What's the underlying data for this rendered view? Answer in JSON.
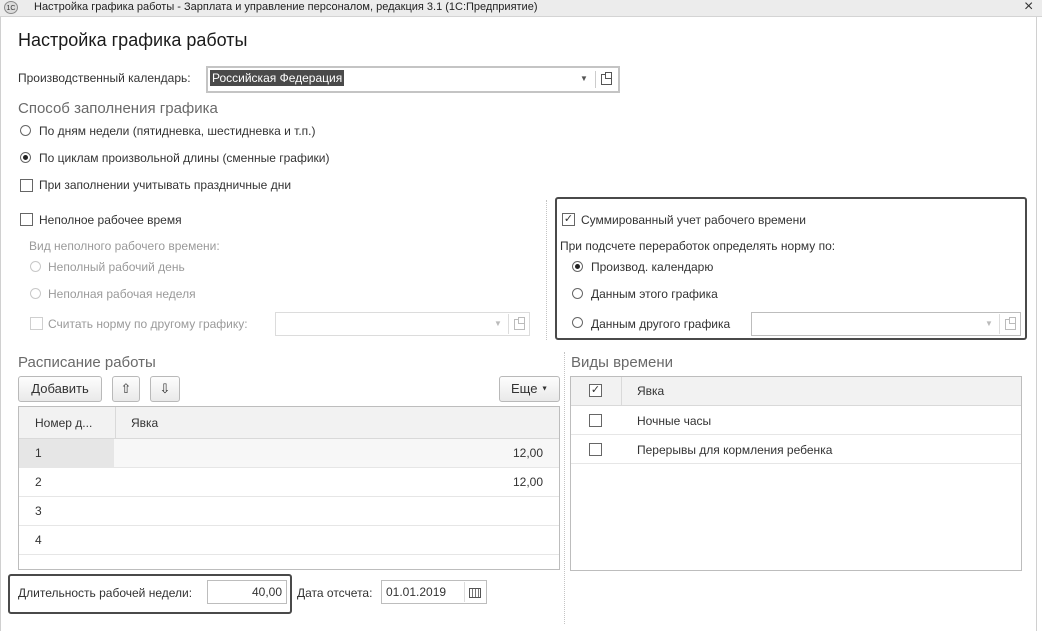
{
  "window": {
    "title": "Настройка графика работы - Зарплата и управление персоналом, редакция 3.1  (1С:Предприятие)",
    "icon_text": "1С",
    "close_glyph": "×"
  },
  "form": {
    "title": "Настройка графика работы"
  },
  "calendar": {
    "label": "Производственный календарь:",
    "value": "Российская Федерация"
  },
  "fill_method": {
    "title": "Способ заполнения графика",
    "option_weekdays": "По дням недели (пятидневка, шестидневка и т.п.)",
    "option_cycles": "По циклам произвольной длины (сменные графики)",
    "selected": "cycles",
    "holidays_label": "При заполнении учитывать праздничные дни",
    "holidays_checked": false
  },
  "part_time": {
    "label": "Неполное рабочее время",
    "checked": false,
    "kind_label": "Вид неполного рабочего времени:",
    "option_day": "Неполный рабочий день",
    "option_week": "Неполная рабочая неделя",
    "norm_other_label": "Считать норму по другому графику:",
    "norm_other_value": ""
  },
  "summary": {
    "label": "Суммированный учет рабочего времени",
    "checked": true,
    "norm_label": "При подсчете переработок определять норму по:",
    "option_calendar": "Производ. календарю",
    "option_this": "Данным этого графика",
    "option_other": "Данным другого графика",
    "selected": "calendar",
    "other_value": ""
  },
  "schedule": {
    "title": "Расписание работы",
    "add_label": "Добавить",
    "more_label": "Еще",
    "col_num": "Номер д...",
    "col_attendance": "Явка",
    "rows": [
      {
        "num": "1",
        "value": "12,00"
      },
      {
        "num": "2",
        "value": "12,00"
      },
      {
        "num": "3",
        "value": ""
      },
      {
        "num": "4",
        "value": ""
      }
    ]
  },
  "time_types": {
    "title": "Виды времени",
    "header_label": "Явка",
    "header_checked": true,
    "items": [
      {
        "label": "Ночные часы",
        "checked": false
      },
      {
        "label": "Перерывы для кормления ребенка",
        "checked": false
      }
    ]
  },
  "footer": {
    "week_duration_label": "Длительность рабочей недели:",
    "week_duration_value": "40,00",
    "ref_date_label": "Дата отсчета:",
    "ref_date_value": "01.01.2019"
  },
  "colors": {
    "highlight_border": "#4a4a4a",
    "selected_value_bg": "#4a4a4a"
  }
}
